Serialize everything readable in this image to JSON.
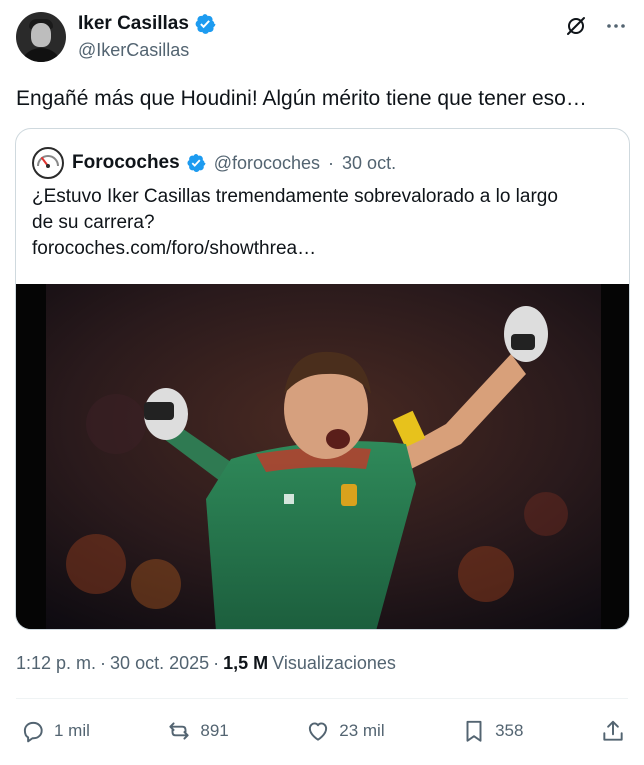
{
  "author": {
    "display_name": "Iker Casillas",
    "handle": "@IkerCasillas",
    "verified_color": "#1d9bf0"
  },
  "tweet": {
    "text": "Engañé más que Houdini! Algún mérito tiene que tener eso…"
  },
  "quoted": {
    "display_name": "Forocoches",
    "handle": "@forocoches",
    "separator": "·",
    "date": "30 oct.",
    "text_line1": "¿Estuvo Iker Casillas tremendamente sobrevalorado a lo largo",
    "text_line2": "de su carrera?",
    "link": "forocoches.com/foro/showthrea…",
    "media_description_icon": "goalkeeper-celebration-photo"
  },
  "meta": {
    "time": "1:12 p. m.",
    "separator1": "·",
    "date": "30 oct. 2025",
    "separator2": "·",
    "views_count": "1,5 M",
    "views_label": "Visualizaciones"
  },
  "actions": {
    "replies": "1 mil",
    "reposts": "891",
    "likes": "23 mil",
    "bookmarks": "358"
  },
  "icons": {
    "top_right": [
      "grok-icon",
      "more-icon"
    ],
    "action_bar": [
      "reply-icon",
      "repost-icon",
      "like-icon",
      "bookmark-icon",
      "share-icon"
    ]
  },
  "colors": {
    "text_primary": "#0f1419",
    "text_secondary": "#536471",
    "border": "#cfd9de",
    "accent_blue": "#1d9bf0"
  }
}
